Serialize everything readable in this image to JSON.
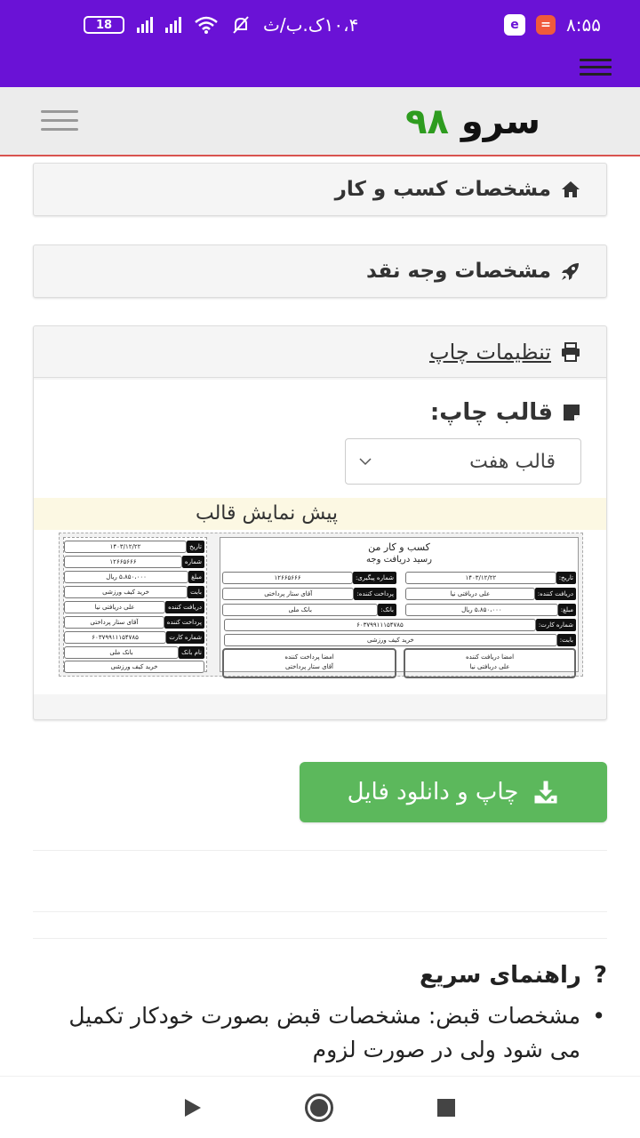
{
  "status_bar": {
    "battery": "18",
    "network_status": "۱۰،۴ک.ب/ث",
    "time": "۸:۵۵"
  },
  "site": {
    "logo_word": "سرو",
    "logo_number": "۹۸"
  },
  "panels": {
    "business": "مشخصات کسب و کار",
    "cash": "مشخصات وجه نقد",
    "print_settings": "تنظیمات چاپ"
  },
  "print": {
    "template_label": "قالب چاپ:",
    "template_value": "قالب هفت",
    "preview_label": "پیش نمایش قالب"
  },
  "receipt": {
    "title": "کسب و کار من",
    "subtitle": "رسید دریافت وجه",
    "labels": {
      "date": "تاریخ:",
      "tracking": "شماره پیگیری:",
      "receiver": "دریافت کننده:",
      "payer": "پرداخت کننده:",
      "amount": "مبلغ:",
      "bank": "بانک:",
      "card": "شماره کارت:",
      "for": "بابت:",
      "sign_receiver": "امضا دریافت کننده",
      "sign_payer": "امضا پرداخت کننده"
    },
    "values": {
      "date": "۱۴۰۳/۱۲/۲۲",
      "tracking": "۱۲۶۶۵۶۶۶",
      "receiver": "علی دریافتی نیا",
      "payer": "آقای ستار پرداختی",
      "amount": "۵،۸۵۰،۰۰۰ ریال",
      "bank": "بانک ملی",
      "card": "۶۰۳۷۹۹۱۱۱۵۴۷۸۵",
      "for": "خرید کیف ورزشی"
    },
    "stub_labels": {
      "date": "تاریخ",
      "number": "شماره",
      "amount": "مبلغ",
      "for": "بابت",
      "receiver": "دریافت کننده",
      "payer": "پرداخت کننده",
      "card": "شماره کارت",
      "bank_name": "نام بانک"
    }
  },
  "actions": {
    "print_download": "چاپ و دانلود فایل"
  },
  "guide": {
    "title": "راهنمای سریع",
    "item_1": "مشخصات قبض: مشخصات قبض بصورت خودکار تکمیل می شود ولی در صورت لزوم"
  },
  "colors": {
    "status_bar": "#6a12d6",
    "accent_red": "#d9534f",
    "button_green": "#5cb85c",
    "logo_green": "#2e9c1f",
    "preview_bg": "#fcf8e3"
  }
}
